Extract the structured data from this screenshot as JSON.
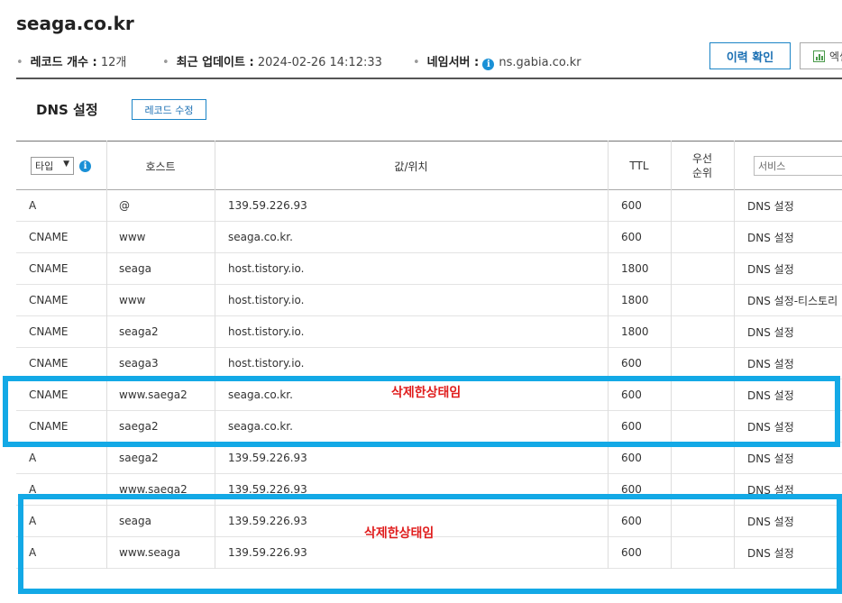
{
  "domain": "seaga.co.kr",
  "info": {
    "record_count_label": "레코드 개수 :",
    "record_count_value": "12개",
    "updated_label": "최근 업데이트 :",
    "updated_value": "2024-02-26 14:12:33",
    "nameserver_label": "네임서버 :",
    "nameserver_value": "ns.gabia.co.kr"
  },
  "buttons": {
    "history": "이력 확인",
    "excel": "엑셀"
  },
  "section": {
    "title": "DNS 설정",
    "edit": "레코드 수정"
  },
  "table": {
    "type_filter_value": "타입",
    "headers": {
      "host": "호스트",
      "value": "값/위치",
      "ttl": "TTL",
      "priority": "우선 순위"
    },
    "service_placeholder": "서비스",
    "rows": [
      {
        "type": "A",
        "host": "@",
        "value": "139.59.226.93",
        "ttl": "600",
        "priority": "",
        "service": "DNS 설정"
      },
      {
        "type": "CNAME",
        "host": "www",
        "value": "seaga.co.kr.",
        "ttl": "600",
        "priority": "",
        "service": "DNS 설정"
      },
      {
        "type": "CNAME",
        "host": "seaga",
        "value": "host.tistory.io.",
        "ttl": "1800",
        "priority": "",
        "service": "DNS 설정"
      },
      {
        "type": "CNAME",
        "host": "www",
        "value": "host.tistory.io.",
        "ttl": "1800",
        "priority": "",
        "service": "DNS 설정-티스토리"
      },
      {
        "type": "CNAME",
        "host": "seaga2",
        "value": "host.tistory.io.",
        "ttl": "1800",
        "priority": "",
        "service": "DNS 설정"
      },
      {
        "type": "CNAME",
        "host": "seaga3",
        "value": "host.tistory.io.",
        "ttl": "600",
        "priority": "",
        "service": "DNS 설정"
      },
      {
        "type": "CNAME",
        "host": "www.saega2",
        "value": "seaga.co.kr.",
        "ttl": "600",
        "priority": "",
        "service": "DNS 설정"
      },
      {
        "type": "CNAME",
        "host": "saega2",
        "value": "seaga.co.kr.",
        "ttl": "600",
        "priority": "",
        "service": "DNS 설정"
      },
      {
        "type": "A",
        "host": "saega2",
        "value": "139.59.226.93",
        "ttl": "600",
        "priority": "",
        "service": "DNS 설정"
      },
      {
        "type": "A",
        "host": "www.saega2",
        "value": "139.59.226.93",
        "ttl": "600",
        "priority": "",
        "service": "DNS 설정"
      },
      {
        "type": "A",
        "host": "seaga",
        "value": "139.59.226.93",
        "ttl": "600",
        "priority": "",
        "service": "DNS 설정"
      },
      {
        "type": "A",
        "host": "www.seaga",
        "value": "139.59.226.93",
        "ttl": "600",
        "priority": "",
        "service": "DNS 설정"
      }
    ]
  },
  "annotations": {
    "note1": "삭제한상태임",
    "note2": "삭제한상태임"
  },
  "colors": {
    "highlight": "#13a9e6",
    "note": "#e01e1e",
    "accent": "#1a84c6"
  }
}
